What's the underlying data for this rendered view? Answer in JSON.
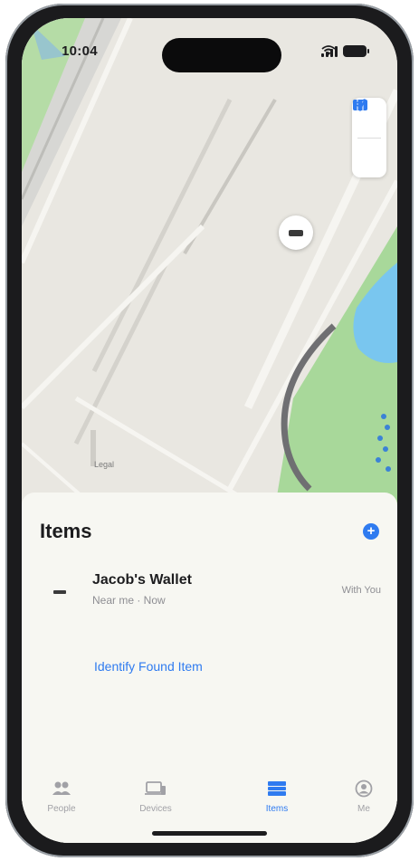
{
  "status_bar": {
    "time": "10:04"
  },
  "map": {
    "legal_label": "Legal",
    "controls": [
      {
        "icon": "map-icon"
      },
      {
        "icon": "location-arrow-icon"
      }
    ]
  },
  "sheet": {
    "title": "Items",
    "add_icon": "plus-icon",
    "items": [
      {
        "name": "Jacob's Wallet",
        "subtitle": "Near me · Now",
        "distance": "With You",
        "icon": "wallet-icon"
      }
    ],
    "identify_link": "Identify Found Item"
  },
  "tabbar": {
    "tabs": [
      {
        "label": "People",
        "icon": "people-icon"
      },
      {
        "label": "Devices",
        "icon": "devices-icon"
      },
      {
        "label": "Items",
        "icon": "items-icon",
        "active": true
      },
      {
        "label": "Me",
        "icon": "me-icon"
      }
    ]
  },
  "colors": {
    "accent": "#2f7bf0",
    "map_green": "#a8d89a",
    "map_water": "#79c6ef",
    "map_background": "#e9e7e1",
    "frame": "#1b1b1d"
  }
}
